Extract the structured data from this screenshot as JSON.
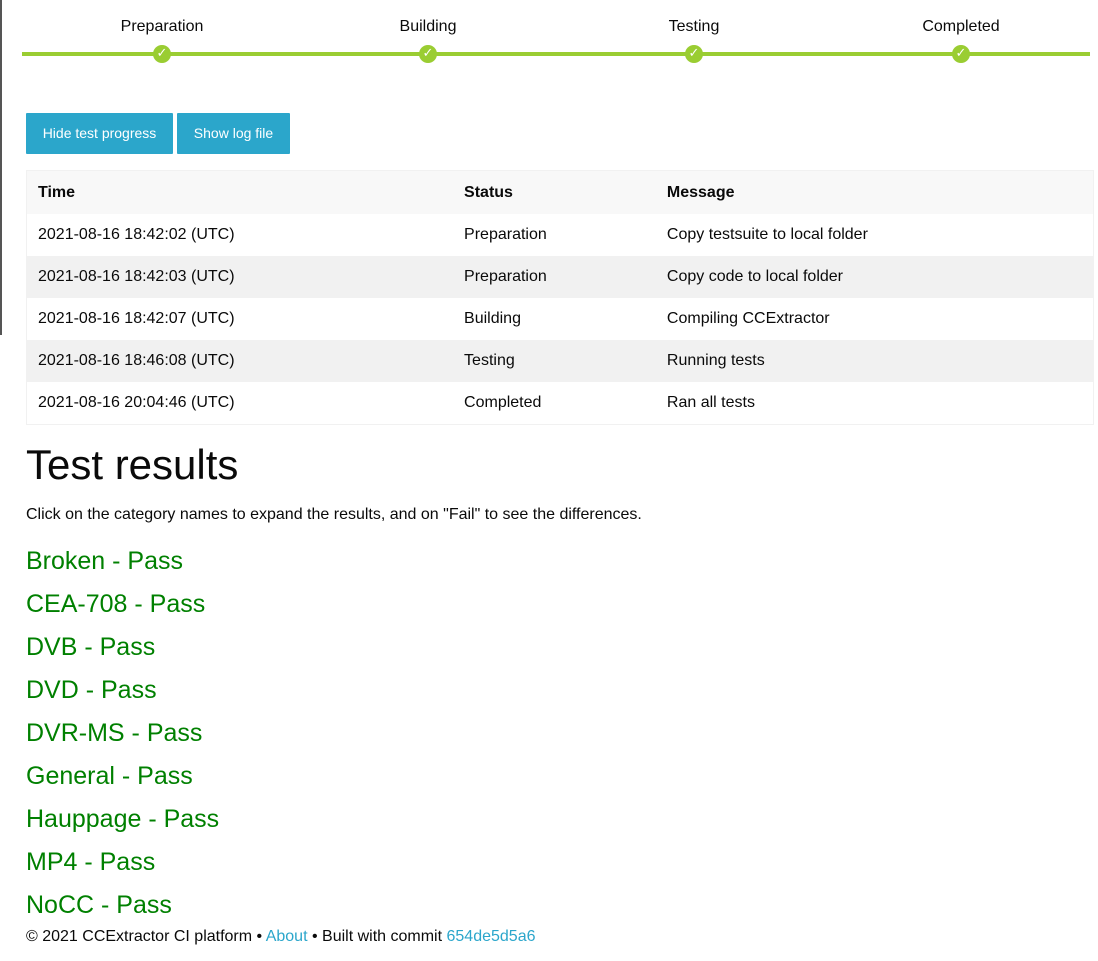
{
  "progress": {
    "steps": [
      {
        "label": "Preparation",
        "check": "✓"
      },
      {
        "label": "Building",
        "check": "✓"
      },
      {
        "label": "Testing",
        "check": "✓"
      },
      {
        "label": "Completed",
        "check": "✓"
      }
    ],
    "color": "#9acd32"
  },
  "buttons": {
    "hide_progress": "Hide test progress",
    "show_log": "Show log file",
    "color": "#2ba6cb"
  },
  "log_table": {
    "headers": [
      "Time",
      "Status",
      "Message"
    ],
    "rows": [
      [
        "2021-08-16 18:42:02 (UTC)",
        "Preparation",
        "Copy testsuite to local folder"
      ],
      [
        "2021-08-16 18:42:03 (UTC)",
        "Preparation",
        "Copy code to local folder"
      ],
      [
        "2021-08-16 18:42:07 (UTC)",
        "Building",
        "Compiling CCExtractor"
      ],
      [
        "2021-08-16 18:46:08 (UTC)",
        "Testing",
        "Running tests"
      ],
      [
        "2021-08-16 20:04:46 (UTC)",
        "Completed",
        "Ran all tests"
      ]
    ]
  },
  "results": {
    "title": "Test results",
    "intro": "Click on the category names to expand the results, and on \"Fail\" to see the differences.",
    "pass_color": "#008000",
    "categories": [
      "Broken - Pass",
      "CEA-708 - Pass",
      "DVB - Pass",
      "DVD - Pass",
      "DVR-MS - Pass",
      "General - Pass",
      "Hauppage - Pass",
      "MP4 - Pass",
      "NoCC - Pass"
    ]
  },
  "footer": {
    "copyright": "© 2021 CCExtractor CI platform •",
    "about": "About",
    "built_with": "• Built with commit",
    "commit": "654de5d5a6",
    "link_color": "#2ba6cb"
  }
}
